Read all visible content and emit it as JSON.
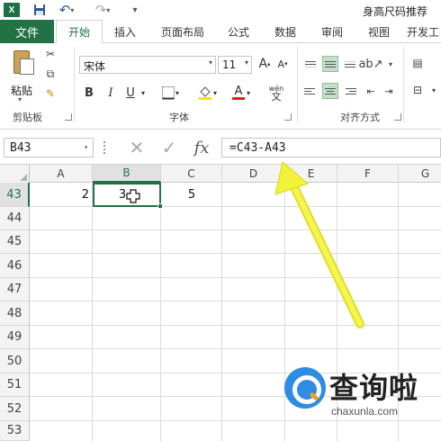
{
  "titlebar": {
    "app_icon": "X",
    "doc_title": "身高尺码推荐",
    "icons": [
      "excel-logo",
      "save-icon",
      "undo-icon",
      "redo-icon",
      "customize-qat-icon"
    ]
  },
  "ribbon_tabs": {
    "file": "文件",
    "tabs": [
      "开始",
      "插入",
      "页面布局",
      "公式",
      "数据",
      "审阅",
      "视图",
      "开发工"
    ],
    "active": "开始"
  },
  "ribbon": {
    "clipboard": {
      "paste_label": "粘贴",
      "group_label": "剪贴板"
    },
    "font": {
      "name": "宋体",
      "size": "11",
      "grow": "A",
      "shrink": "A",
      "bold": "B",
      "italic": "I",
      "underline": "U",
      "font_color": "A",
      "phonetic": "wén",
      "group_label": "字体"
    },
    "alignment": {
      "group_label": "对齐方式"
    }
  },
  "formula_bar": {
    "name_box": "B43",
    "cancel": "✕",
    "enter": "✓",
    "fx": "fx",
    "formula": "=C43-A43"
  },
  "sheet": {
    "columns": [
      "A",
      "B",
      "C",
      "D",
      "E",
      "F",
      "G"
    ],
    "selected_column": "B",
    "rows": [
      "43",
      "44",
      "45",
      "46",
      "47",
      "48",
      "49",
      "50",
      "51",
      "52",
      "53"
    ],
    "selected_row": "43",
    "cells": {
      "A43": "2",
      "B43": "3",
      "C43": "5"
    }
  },
  "watermark": {
    "brand": "查询啦",
    "url": "chaxunla.com"
  },
  "colors": {
    "accent": "#217346",
    "arrow": "#f2f23a",
    "watermark_blue": "#2e8ce3"
  }
}
